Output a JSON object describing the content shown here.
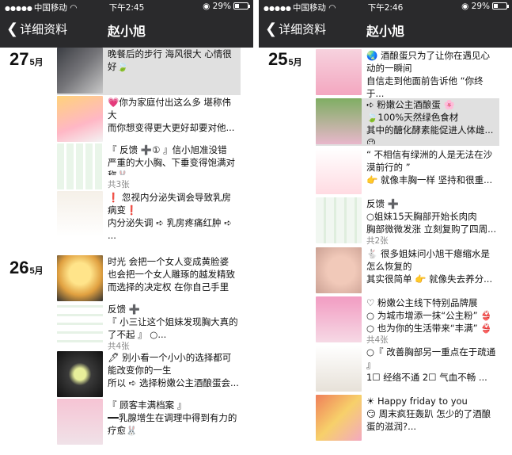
{
  "left": {
    "status": {
      "carrier": "中国移动",
      "time": "下午2:45",
      "battery": "29%"
    },
    "nav": {
      "back_label": "详细资料",
      "title": "赵小旭"
    },
    "dates": [
      {
        "day": "27",
        "month": "5月"
      },
      {
        "day": "26",
        "month": "5月"
      }
    ],
    "posts": [
      {
        "text": "晚餐后的步行  海风很大  心情很好🍃",
        "count": ""
      },
      {
        "text": "💗你为家庭付出这么多  堪称伟大\n而你想变得更大更好却要对他...",
        "count": ""
      },
      {
        "text": "『 反馈 ➕① 』信小旭准没错\n严重的大小胸、下垂变得饱满对称🐰",
        "count": "共3张"
      },
      {
        "text": "❗ 忽视内分泌失调会导致乳房病变❗\n内分泌失调 ➪ 乳房疼痛红肿 ➪ ...",
        "count": ""
      },
      {
        "text": "时光  会把一个女人变成黄脸婆\n也会把一个女人雕琢的越发精致\n而选择的决定权  在你自己手里",
        "count": ""
      },
      {
        "text": "反馈 ➕\n『 小三让这个姐妹发现胸大真的了不起 』 ○...",
        "count": "共4张"
      },
      {
        "text": "🖋 别小看一个小小的选择都可能改变你的一生\n所以 ➪ 选择粉嫩公主酒酿蛋会...",
        "count": ""
      },
      {
        "text": "『 顾客丰满档案 』\n━━乳腺增生在调理中得到有力的疗愈🐰",
        "count": ""
      }
    ]
  },
  "right": {
    "status": {
      "carrier": "中国移动",
      "time": "下午2:46",
      "battery": "29%"
    },
    "nav": {
      "back_label": "详细资料",
      "title": "赵小旭"
    },
    "dates": [
      {
        "day": "25",
        "month": "5月"
      }
    ],
    "posts": [
      {
        "text": "🌏 酒酿蛋只为了让你在遇见心动的一瞬间\n自信走到他面前告诉他 “你终于...",
        "count": ""
      },
      {
        "text": "➪ 粉嫩公主酒酿蛋 🌸\n🍃100%天然绿色食材\n其中的醣化酵素能促进人体雌...😉",
        "count": ""
      },
      {
        "text": "“ 不相信有绿洲的人是无法在沙漠前行的 ”\n👉 就像丰胸一样  坚持和很重...",
        "count": ""
      },
      {
        "text": "反馈 ➕\n○姐妹15天胸部开始长肉肉\n胸部微微发涨  立刻复购了四周...",
        "count": "共2张"
      },
      {
        "text": "🐇 很多姐妹问小旭干瘪缩水是怎么恢复的\n其实很简单  👉 就像失去养分...",
        "count": ""
      },
      {
        "text": "♡ 粉嫩公主线下特别品牌展\n○ 为城市增添一抹“公主粉” 👙\n○ 也为你的生活带来“丰满” 👙",
        "count": "共4张"
      },
      {
        "text": "○『 改善胸部另一重点在于疏通 』\n1☐ 经络不通  2☐ 气血不畅 ...",
        "count": ""
      },
      {
        "text": "☀ Happy friday to you\n😏 周末疯狂轰趴  怎少的了酒酿蛋的滋润?...",
        "count": ""
      }
    ]
  },
  "colors": {
    "topbar": "#2a2a2c",
    "highlight": "#e0e0e0",
    "text": "#111111",
    "count": "#888888"
  },
  "icons": [
    "back-chevron-icon",
    "wifi-icon",
    "alarm-icon",
    "battery-icon",
    "signal-dots-icon"
  ]
}
